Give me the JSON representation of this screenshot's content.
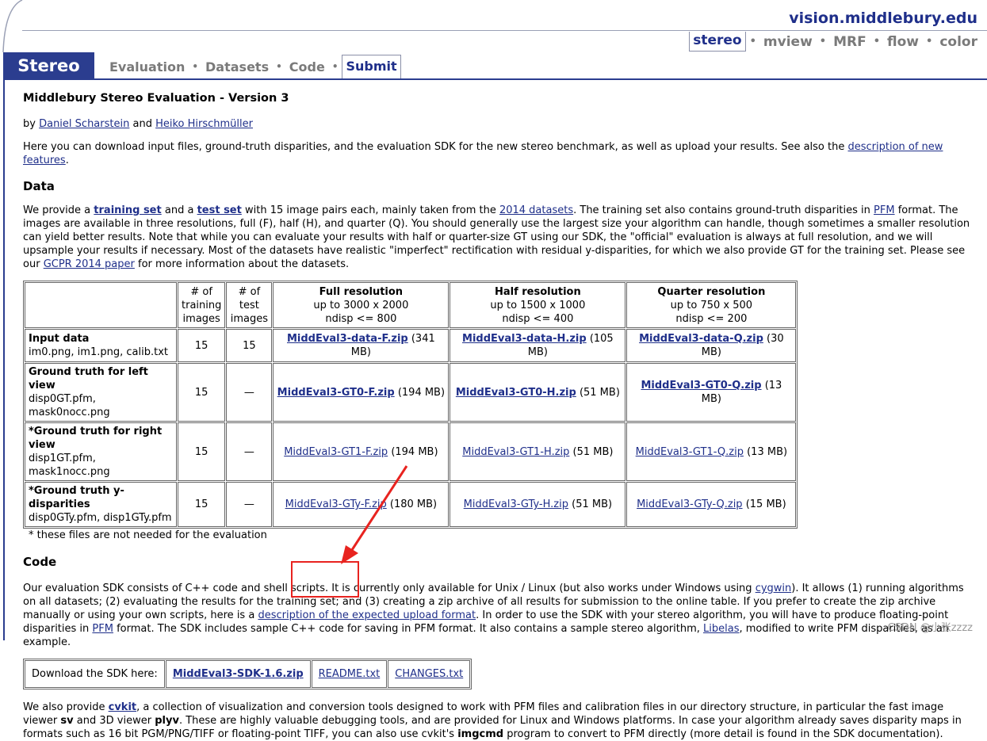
{
  "site": {
    "name": "vision.middlebury.edu"
  },
  "topnav": [
    {
      "label": "stereo",
      "active": true
    },
    {
      "label": "mview",
      "active": false
    },
    {
      "label": "MRF",
      "active": false
    },
    {
      "label": "flow",
      "active": false
    },
    {
      "label": "color",
      "active": false
    }
  ],
  "logo": "Stereo",
  "mainnav": [
    {
      "label": "Evaluation",
      "active": false
    },
    {
      "label": "Datasets",
      "active": false
    },
    {
      "label": "Code",
      "active": false
    },
    {
      "label": "Submit",
      "active": true
    }
  ],
  "page": {
    "title": "Middlebury Stereo Evaluation - Version 3",
    "by": "by",
    "author1": "Daniel Scharstein",
    "and": "and",
    "author2": "Heiko Hirschmüller",
    "intro": "Here you can download input files, ground-truth disparities, and the evaluation SDK for the new stereo benchmark, as well as upload your results. See also the",
    "intro_link": "description of new features",
    "intro_end": "."
  },
  "data_section": {
    "heading": "Data",
    "p1": "We provide a",
    "training_set": "training set",
    "p2": "and a",
    "test_set": "test set",
    "p3": "with 15 image pairs each, mainly taken from the",
    "datasets_2014": "2014 datasets",
    "p4": ". The training set also contains ground-truth disparities in",
    "pfm": "PFM",
    "p5": "format. The images are available in three resolutions, full (F), half (H), and quarter (Q). You should generally use the largest size your algorithm can handle, though sometimes a smaller resolution can yield better results. Note that while you can evaluate your results with half or quarter-size GT using our SDK, the \"official\" evaluation is always at full resolution, and we will upsample your results if necessary. Most of the datasets have realistic \"imperfect\" rectification with residual y-disparities, for which we also provide GT for the training set. Please see our",
    "gcpr": "GCPR 2014 paper",
    "p6": "for more information about the datasets."
  },
  "data_table": {
    "headers": {
      "training": [
        "# of",
        "training",
        "images"
      ],
      "test": [
        "# of",
        "test",
        "images"
      ],
      "full": [
        "Full resolution",
        "up to 3000 x 2000",
        "ndisp <= 800"
      ],
      "half": [
        "Half resolution",
        "up to 1500 x 1000",
        "ndisp <= 400"
      ],
      "quarter": [
        "Quarter resolution",
        "up to 750 x 500",
        "ndisp <= 200"
      ]
    },
    "rows": [
      {
        "title": "Input data",
        "files": "im0.png, im1.png, calib.txt",
        "training": "15",
        "test": "15",
        "full": "MiddEval3-data-F.zip",
        "full_size": "(341 MB)",
        "half": "MiddEval3-data-H.zip",
        "half_size": "(105 MB)",
        "quarter": "MiddEval3-data-Q.zip",
        "quarter_size": "(30 MB)",
        "bold": true
      },
      {
        "title": "Ground truth for left view",
        "files": "disp0GT.pfm, mask0nocc.png",
        "training": "15",
        "test": "—",
        "full": "MiddEval3-GT0-F.zip",
        "full_size": "(194 MB)",
        "half": "MiddEval3-GT0-H.zip",
        "half_size": "(51 MB)",
        "quarter": "MiddEval3-GT0-Q.zip",
        "quarter_size": "(13 MB)",
        "bold": true
      },
      {
        "title": "*Ground truth for right view",
        "files": "disp1GT.pfm, mask1nocc.png",
        "training": "15",
        "test": "—",
        "full": "MiddEval3-GT1-F.zip",
        "full_size": "(194 MB)",
        "half": "MiddEval3-GT1-H.zip",
        "half_size": "(51 MB)",
        "quarter": "MiddEval3-GT1-Q.zip",
        "quarter_size": "(13 MB)",
        "bold": false
      },
      {
        "title": "*Ground truth y-disparities",
        "files": "disp0GTy.pfm, disp1GTy.pfm",
        "training": "15",
        "test": "—",
        "full": "MiddEval3-GTy-F.zip",
        "full_size": "(180 MB)",
        "half": "MiddEval3-GTy-H.zip",
        "half_size": "(51 MB)",
        "quarter": "MiddEval3-GTy-Q.zip",
        "quarter_size": "(15 MB)",
        "bold": false
      }
    ],
    "footnote": "* these files are not needed for the evaluation"
  },
  "code_section": {
    "heading": "Code",
    "p1": "Our evaluation SDK consists of C++ code and shell scripts. It is currently only available for Unix / Linux (but also works under Windows using",
    "cygwin": "cygwin",
    "p2": "). It allows (1) running algorithms on all datasets; (2) evaluating the results for the training set; and (3) creating a zip archive of all results for submission to the online table. If you prefer to create the zip archive manually or using your own scripts, here is a",
    "upload_format": "description of the expected upload format",
    "p3": ". In order to use the SDK with your stereo algorithm, you will have to produce floating-point disparities in",
    "pfm": "PFM",
    "p4": "format. The SDK includes sample C++ code for saving in PFM format. It also contains a sample stereo algorithm,",
    "libelas": "Libelas",
    "p5": ", modified to write PFM disparities, as an example."
  },
  "sdk": {
    "label": "Download the SDK here:",
    "zip": "MiddEval3-SDK-1.6.zip",
    "readme": "README.txt",
    "changes": "CHANGES.txt"
  },
  "cvkit": {
    "p1": "We also provide",
    "cvkit": "cvkit",
    "p2": ", a collection of visualization and conversion tools designed to work with PFM files and calibration files in our directory structure, in particular the fast image viewer",
    "sv": "sv",
    "p3": "and 3D viewer",
    "plyv": "plyv",
    "p4": ". These are highly valuable debugging tools, and are provided for Linux and Windows platforms. In case your algorithm already saves disparity maps in formats such as 16 bit PGM/PNG/TIFF or floating-point TIFF, you can also use cvkit's",
    "imgcmd": "imgcmd",
    "p5": "program to convert to PFM directly (more detail is found in the SDK documentation)."
  },
  "watermark": "CSDN @小张zzzz",
  "colors": {
    "brand": "#2b3d8f",
    "link": "#1f2f8a",
    "annotation": "#e8231f"
  }
}
